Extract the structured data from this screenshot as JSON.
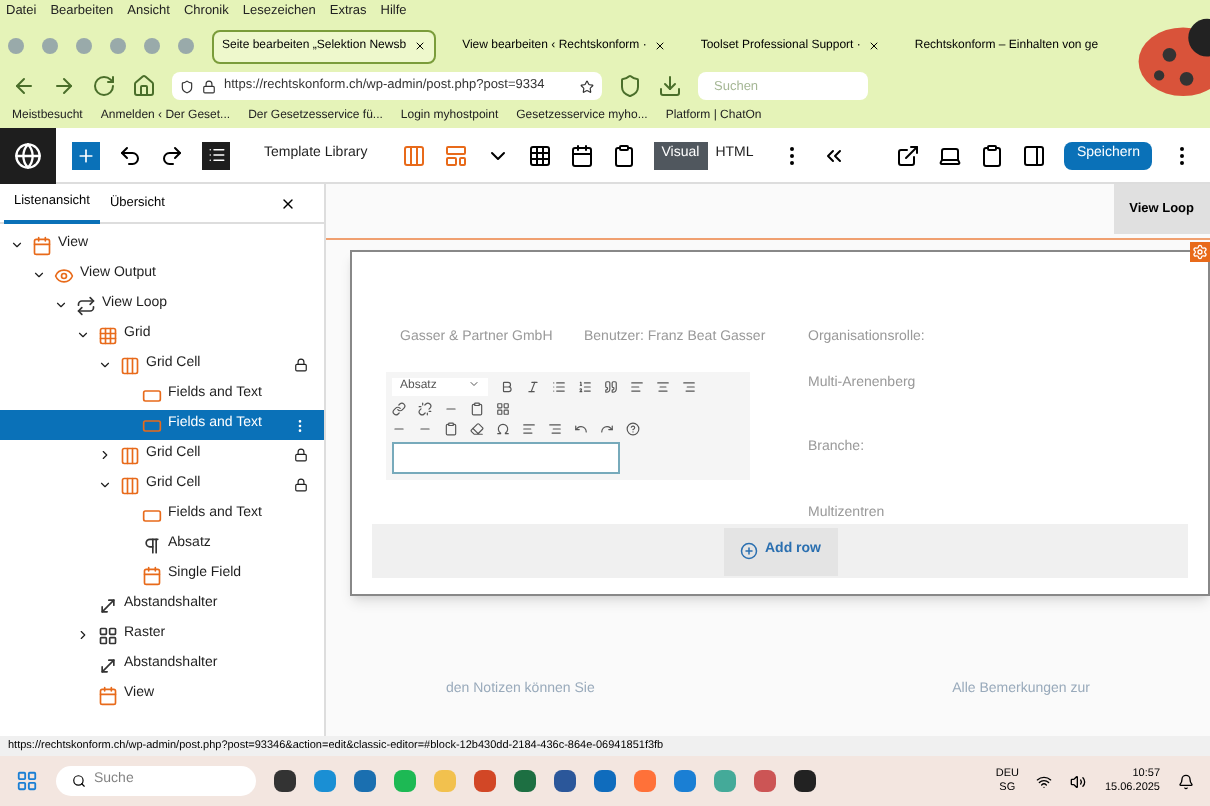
{
  "menu": [
    "Datei",
    "Bearbeiten",
    "Ansicht",
    "Chronik",
    "Lesezeichen",
    "Extras",
    "Hilfe"
  ],
  "browser_tabs": [
    {
      "label": "Seite bearbeiten „Selektion Newsb",
      "selected": true
    },
    {
      "label": "View bearbeiten ‹ Rechtskonform ·",
      "selected": false
    },
    {
      "label": "Toolset Professional Support · ",
      "selected": false
    },
    {
      "label": "Rechtskonform – Einhalten von ge",
      "selected": false
    }
  ],
  "address_bar": {
    "value": "https://rechtskonform.ch/wp-admin/post.php?post=9334"
  },
  "search": {
    "placeholder": "Suchen"
  },
  "bookmarks": [
    "Meistbesucht",
    "Anmelden ‹ Der Geset...",
    "Der Gesetzesservice fü...",
    "Login myhostpoint",
    "Gesetzesservice myho...",
    "Platform | ChatOn"
  ],
  "editor_toolbar": {
    "template_library": "Template Library",
    "modes": [
      {
        "label": "Visual",
        "selected": true
      },
      {
        "label": "HTML",
        "selected": false
      }
    ],
    "save": "Speichern"
  },
  "sidebar": {
    "tabs": [
      {
        "label": "Listenansicht",
        "selected": true
      },
      {
        "label": "Übersicht",
        "selected": false
      }
    ],
    "tree": [
      {
        "label": "View",
        "kind": "view",
        "expanded": true,
        "children": [
          {
            "label": "View Output",
            "kind": "output",
            "expanded": true,
            "children": [
              {
                "label": "View Loop",
                "kind": "loop",
                "expanded": true,
                "children": [
                  {
                    "label": "Grid",
                    "kind": "grid",
                    "expanded": true,
                    "children": [
                      {
                        "label": "Grid Cell",
                        "kind": "cell",
                        "expanded": true,
                        "locked": true,
                        "children": [
                          {
                            "label": "Fields and Text",
                            "kind": "fields",
                            "selected": false
                          },
                          {
                            "label": "Fields and Text",
                            "kind": "fields",
                            "selected": true
                          }
                        ]
                      },
                      {
                        "label": "Grid Cell",
                        "kind": "cell",
                        "expanded": false,
                        "locked": true
                      },
                      {
                        "label": "Grid Cell",
                        "kind": "cell",
                        "expanded": true,
                        "locked": true,
                        "children": [
                          {
                            "label": "Fields and Text",
                            "kind": "fields",
                            "selected": false
                          },
                          {
                            "label": "Absatz",
                            "kind": "paragraph",
                            "selected": false
                          },
                          {
                            "label": "Single Field",
                            "kind": "single",
                            "selected": false
                          }
                        ]
                      }
                    ]
                  },
                  {
                    "label": "Abstandshalter",
                    "kind": "spacer"
                  },
                  {
                    "label": "Raster",
                    "kind": "raster",
                    "expanded": false
                  },
                  {
                    "label": "Abstandshalter",
                    "kind": "spacer"
                  },
                  {
                    "label": "View",
                    "kind": "view"
                  }
                ]
              }
            ]
          }
        ]
      }
    ]
  },
  "canvas": {
    "block_tab": "View Loop",
    "columns": [
      [
        "Gasser & Partner GmbH"
      ],
      [
        "Benutzer: Franz Beat Gasser"
      ],
      [
        "Organisationsrolle:",
        "Multi-Arenenberg",
        "Branche:",
        "Multizentren"
      ]
    ],
    "format_select": "Absatz",
    "add_row": "Add row",
    "below": [
      "den Notizen können Sie",
      "Alle Bemerkungen zur"
    ]
  },
  "status_url": "https://rechtskonform.ch/wp-admin/post.php?post=93346&action=edit&classic-editor=#block-12b430dd-2184-436c-864e-06941851f3fb",
  "taskbar": {
    "search": {
      "placeholder": "Suche"
    },
    "language": "DEU",
    "region": "SG",
    "time": "10:57",
    "date": "15.06.2025"
  }
}
